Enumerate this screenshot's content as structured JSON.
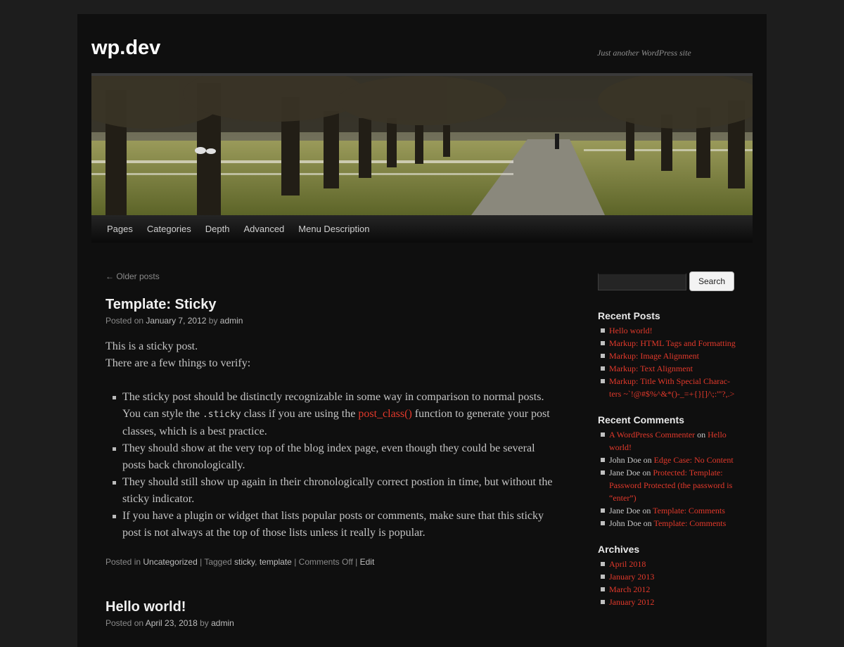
{
  "site": {
    "title": "wp.dev",
    "description": "Just another WordPress site"
  },
  "menu": [
    "Pages",
    "Categories",
    "Depth",
    "Advanced",
    "Menu Description"
  ],
  "nav": {
    "older_posts": "← Older posts"
  },
  "post1": {
    "title": "Template: Sticky",
    "posted_on_prefix": "Posted on ",
    "date": "January 7, 2012",
    "by_text": " by ",
    "author": "admin",
    "para1": "This is a sticky post.",
    "para2": "There are a few things to verify:",
    "bullets": [
      {
        "before": "The sticky post should be distinctly recognizable in some way in comparison to normal posts. You can style the ",
        "code": ".sticky",
        "middle": " class if you are using the ",
        "link": "post_class()",
        "after": " function to generate your post classes, which is a best practice."
      },
      "They should show at the very top of the blog index page, even though they could be several posts back chronologically.",
      "They should still show up again in their chronologically correct postion in time, but without the sticky indicator.",
      "If you have a plugin or widget that lists popular posts or comments, make sure that this sticky post is not always at the top of those lists unless it really is popular."
    ],
    "footer": {
      "posted_in": "Posted in ",
      "category": "Uncategorized",
      "tagged": " | Tagged ",
      "tag1": "sticky",
      "comma": ", ",
      "tag2": "template",
      "comments_sep": " | ",
      "comments": "Comments Off",
      "edit_sep": " | ",
      "edit": "Edit"
    }
  },
  "post2": {
    "title": "Hello world!",
    "posted_on_prefix": "Posted on ",
    "date": "April 23, 2018",
    "by_text": " by ",
    "author": "admin"
  },
  "search": {
    "button": "Search",
    "value": ""
  },
  "recent_posts": {
    "title": "Recent Posts",
    "items": [
      "Hello world!",
      "Markup: HTML Tags and Format­ting",
      "Markup: Image Alignment",
      "Markup: Text Alignment",
      "Markup: Title With Special Charac­ters ~`!@#$%^&*()-_=+{}[]/\\;:'\"?,.>"
    ]
  },
  "recent_comments": {
    "title": "Recent Comments",
    "items": [
      {
        "author": "A WordPress Commenter",
        "on": " on ",
        "post": "Hello world!",
        "author_link": true
      },
      {
        "author": "John Doe",
        "on": " on ",
        "post": "Edge Case: No Con­tent",
        "author_link": false
      },
      {
        "author": "Jane Doe",
        "on": " on ",
        "post": "Protected: Template: Password Protected (the password is “enter”)",
        "author_link": false
      },
      {
        "author": "Jane Doe",
        "on": " on ",
        "post": "Template: Comments",
        "author_link": false
      },
      {
        "author": "John Doe",
        "on": " on ",
        "post": "Template: Comments",
        "author_link": false
      }
    ]
  },
  "archives": {
    "title": "Archives",
    "items": [
      "April 2018",
      "January 2013",
      "March 2012",
      "January 2012"
    ]
  },
  "colors": {
    "link": "#e3392b",
    "background": "#0f0f0f",
    "page": "#1d1d1d"
  }
}
